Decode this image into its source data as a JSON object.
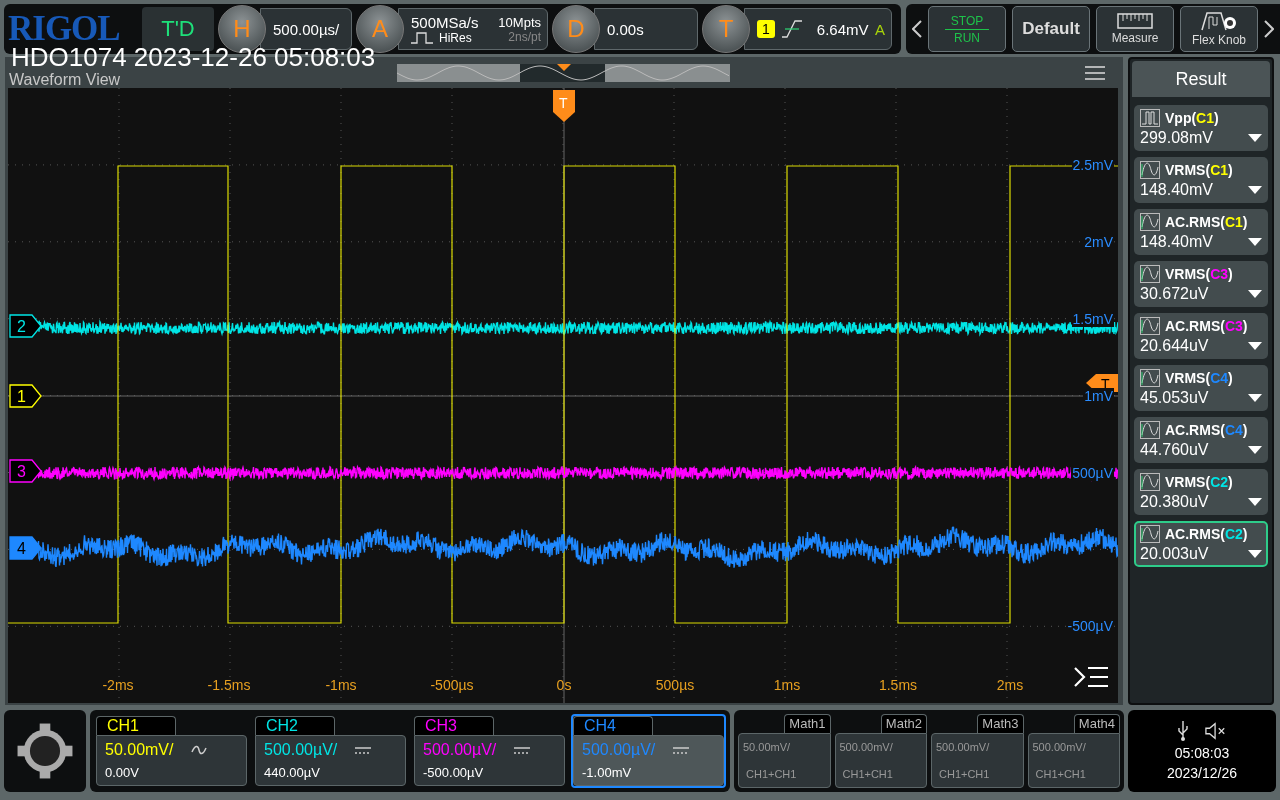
{
  "header": {
    "logo": "RIGOL",
    "mode": "T'D",
    "overlay_title": "HDO1074 2023-12-26 05:08:03",
    "horizontal": {
      "key": "H",
      "value": "500.00µs/"
    },
    "acquisition": {
      "key": "A",
      "rate": "500MSa/s",
      "depth": "10Mpts",
      "mode": "HiRes",
      "resolution": "2ns/pt"
    },
    "delay": {
      "key": "D",
      "value": "0.00s"
    },
    "trigger": {
      "key": "T",
      "source": "1",
      "level": "6.64mV",
      "sweep": "A"
    },
    "run_control": {
      "top": "STOP",
      "bottom": "RUN"
    },
    "buttons": [
      {
        "kind": "default",
        "label": "Default"
      },
      {
        "kind": "measure",
        "label": "Measure"
      },
      {
        "kind": "knob",
        "label": "Flex Knob"
      }
    ]
  },
  "waveform_view": {
    "title": "Waveform View",
    "traces": [
      {
        "label": "2",
        "color": "#00e5e5",
        "kind": "noise"
      },
      {
        "label": "1",
        "color": "#ffff00",
        "kind": "square"
      },
      {
        "label": "3",
        "color": "#ff00ff",
        "kind": "noise"
      },
      {
        "label": "4",
        "color": "#1e88ff",
        "kind": "wander"
      }
    ],
    "trigger_marker": "T",
    "level_marker": "T",
    "y_labels": [
      "2.5mV",
      "2mV",
      "1.5mV",
      "1mV",
      "500µV",
      "-500µV"
    ],
    "x_labels": [
      "-2ms",
      "-1.5ms",
      "-1ms",
      "-500µs",
      "0s",
      "500µs",
      "1ms",
      "1.5ms",
      "2ms"
    ]
  },
  "result": {
    "title": "Result",
    "items": [
      {
        "kind": "pulse",
        "prefix": "Vpp(",
        "source": "C1",
        "suffix": ")",
        "color": "#ffff00",
        "value": "299.08mV",
        "selected": false
      },
      {
        "kind": "wave",
        "prefix": "VRMS(",
        "source": "C1",
        "suffix": ")",
        "color": "#ffff00",
        "value": "148.40mV",
        "selected": false
      },
      {
        "kind": "wave",
        "prefix": "AC.RMS(",
        "source": "C1",
        "suffix": ")",
        "color": "#ffff00",
        "value": "148.40mV",
        "selected": false
      },
      {
        "kind": "wave",
        "prefix": "VRMS(",
        "source": "C3",
        "suffix": ")",
        "color": "#ff00ff",
        "value": "30.672uV",
        "selected": false
      },
      {
        "kind": "wave",
        "prefix": "AC.RMS(",
        "source": "C3",
        "suffix": ")",
        "color": "#ff00ff",
        "value": "20.644uV",
        "selected": false
      },
      {
        "kind": "wave",
        "prefix": "VRMS(",
        "source": "C4",
        "suffix": ")",
        "color": "#1e88ff",
        "value": "45.053uV",
        "selected": false
      },
      {
        "kind": "wave",
        "prefix": "AC.RMS(",
        "source": "C4",
        "suffix": ")",
        "color": "#1e88ff",
        "value": "44.760uV",
        "selected": false
      },
      {
        "kind": "wave",
        "prefix": "VRMS(",
        "source": "C2",
        "suffix": ")",
        "color": "#00e5e5",
        "value": "20.380uV",
        "selected": false
      },
      {
        "kind": "wave",
        "prefix": "AC.RMS(",
        "source": "C2",
        "suffix": ")",
        "color": "#00e5e5",
        "value": "20.003uV",
        "selected": true
      }
    ]
  },
  "channels": [
    {
      "name": "CH1",
      "color": "#ffff00",
      "scale": "50.00mV/",
      "kind": "ac",
      "offset": "0.00V",
      "selected": false
    },
    {
      "name": "CH2",
      "color": "#00e5e5",
      "scale": "500.00µV/",
      "kind": "dc",
      "offset": "440.00µV",
      "selected": false
    },
    {
      "name": "CH3",
      "color": "#ff00ff",
      "scale": "500.00µV/",
      "kind": "dc",
      "offset": "-500.00µV",
      "selected": false
    },
    {
      "name": "CH4",
      "color": "#1e88ff",
      "scale": "500.00µV/",
      "kind": "dc",
      "offset": "-1.00mV",
      "selected": true
    }
  ],
  "math": [
    {
      "name": "Math1",
      "scale": "50.00mV/",
      "source": "CH1+CH1"
    },
    {
      "name": "Math2",
      "scale": "500.00mV/",
      "source": "CH1+CH1"
    },
    {
      "name": "Math3",
      "scale": "500.00mV/",
      "source": "CH1+CH1"
    },
    {
      "name": "Math4",
      "scale": "500.00mV/",
      "source": "CH1+CH1"
    }
  ],
  "status": {
    "time": "05:08:03",
    "date": "2023/12/26"
  }
}
